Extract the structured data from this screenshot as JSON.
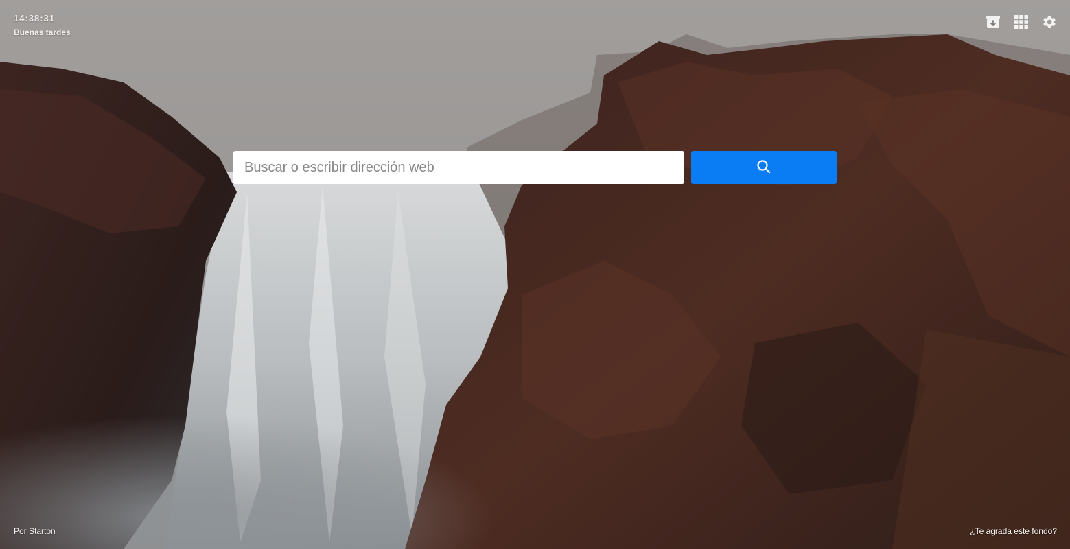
{
  "header": {
    "clock": "14:38:31",
    "greeting": "Buenas tardes"
  },
  "toolbar": {
    "icons": [
      "archive-download-icon",
      "apps-grid-icon",
      "gear-icon"
    ]
  },
  "search": {
    "placeholder": "Buscar o escribir dirección web",
    "button_icon": "search-icon"
  },
  "footer": {
    "credit": "Por Starton",
    "wallpaper_prompt": "¿Te agrada este fondo?"
  },
  "colors": {
    "accent": "#0a7df5",
    "sky": "#9d9a98",
    "rock": "#4a2b24"
  }
}
